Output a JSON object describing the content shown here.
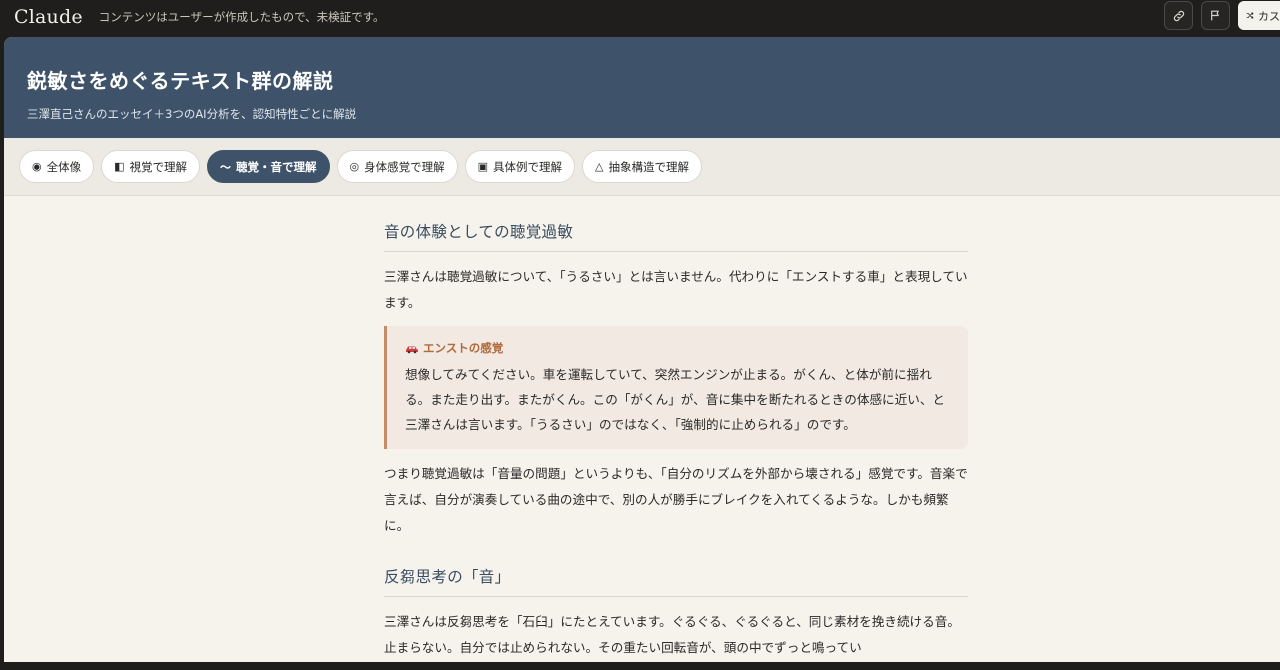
{
  "topbar": {
    "brand": "Claude",
    "notice": "コンテンツはユーザーが作成したもので、未検証です。",
    "link_icon": "link-icon",
    "flag_icon": "flag-icon",
    "remix_label": "カス"
  },
  "hero": {
    "title": "鋭敏さをめぐるテキスト群の解説",
    "subtitle": "三澤直己さんのエッセイ＋3つのAI分析を、認知特性ごとに解説"
  },
  "tabs": [
    {
      "glyph": "◉",
      "label": "全体像"
    },
    {
      "glyph": "◧",
      "label": "視覚で理解"
    },
    {
      "glyph": "〜",
      "label": "聴覚・音で理解"
    },
    {
      "glyph": "◎",
      "label": "身体感覚で理解"
    },
    {
      "glyph": "▣",
      "label": "具体例で理解"
    },
    {
      "glyph": "△",
      "label": "抽象構造で理解"
    }
  ],
  "active_tab": 2,
  "content": {
    "section1_title": "音の体験としての聴覚過敏",
    "para1": "三澤さんは聴覚過敏について、「うるさい」とは言いません。代わりに「エンストする車」と表現しています。",
    "callout": {
      "icon": "car-icon",
      "title": "エンストの感覚",
      "body": "想像してみてください。車を運転していて、突然エンジンが止まる。がくん、と体が前に揺れる。また走り出す。またがくん。この「がくん」が、音に集中を断たれるときの体感に近い、と三澤さんは言います。「うるさい」のではなく、「強制的に止められる」のです。"
    },
    "para2": "つまり聴覚過敏は「音量の問題」というよりも、「自分のリズムを外部から壊される」感覚です。音楽で言えば、自分が演奏している曲の途中で、別の人が勝手にブレイクを入れてくるような。しかも頻繁に。",
    "section2_title": "反芻思考の「音」",
    "para3": "三澤さんは反芻思考を「石臼」にたとえています。ぐるぐる、ぐるぐると、同じ素材を挽き続ける音。止まらない。自分では止められない。その重たい回転音が、頭の中でずっと鳴ってい"
  },
  "colors": {
    "hero_bg": "#3e5369",
    "page_bg": "#f6f2ec",
    "callout_accent": "#c28e67"
  }
}
